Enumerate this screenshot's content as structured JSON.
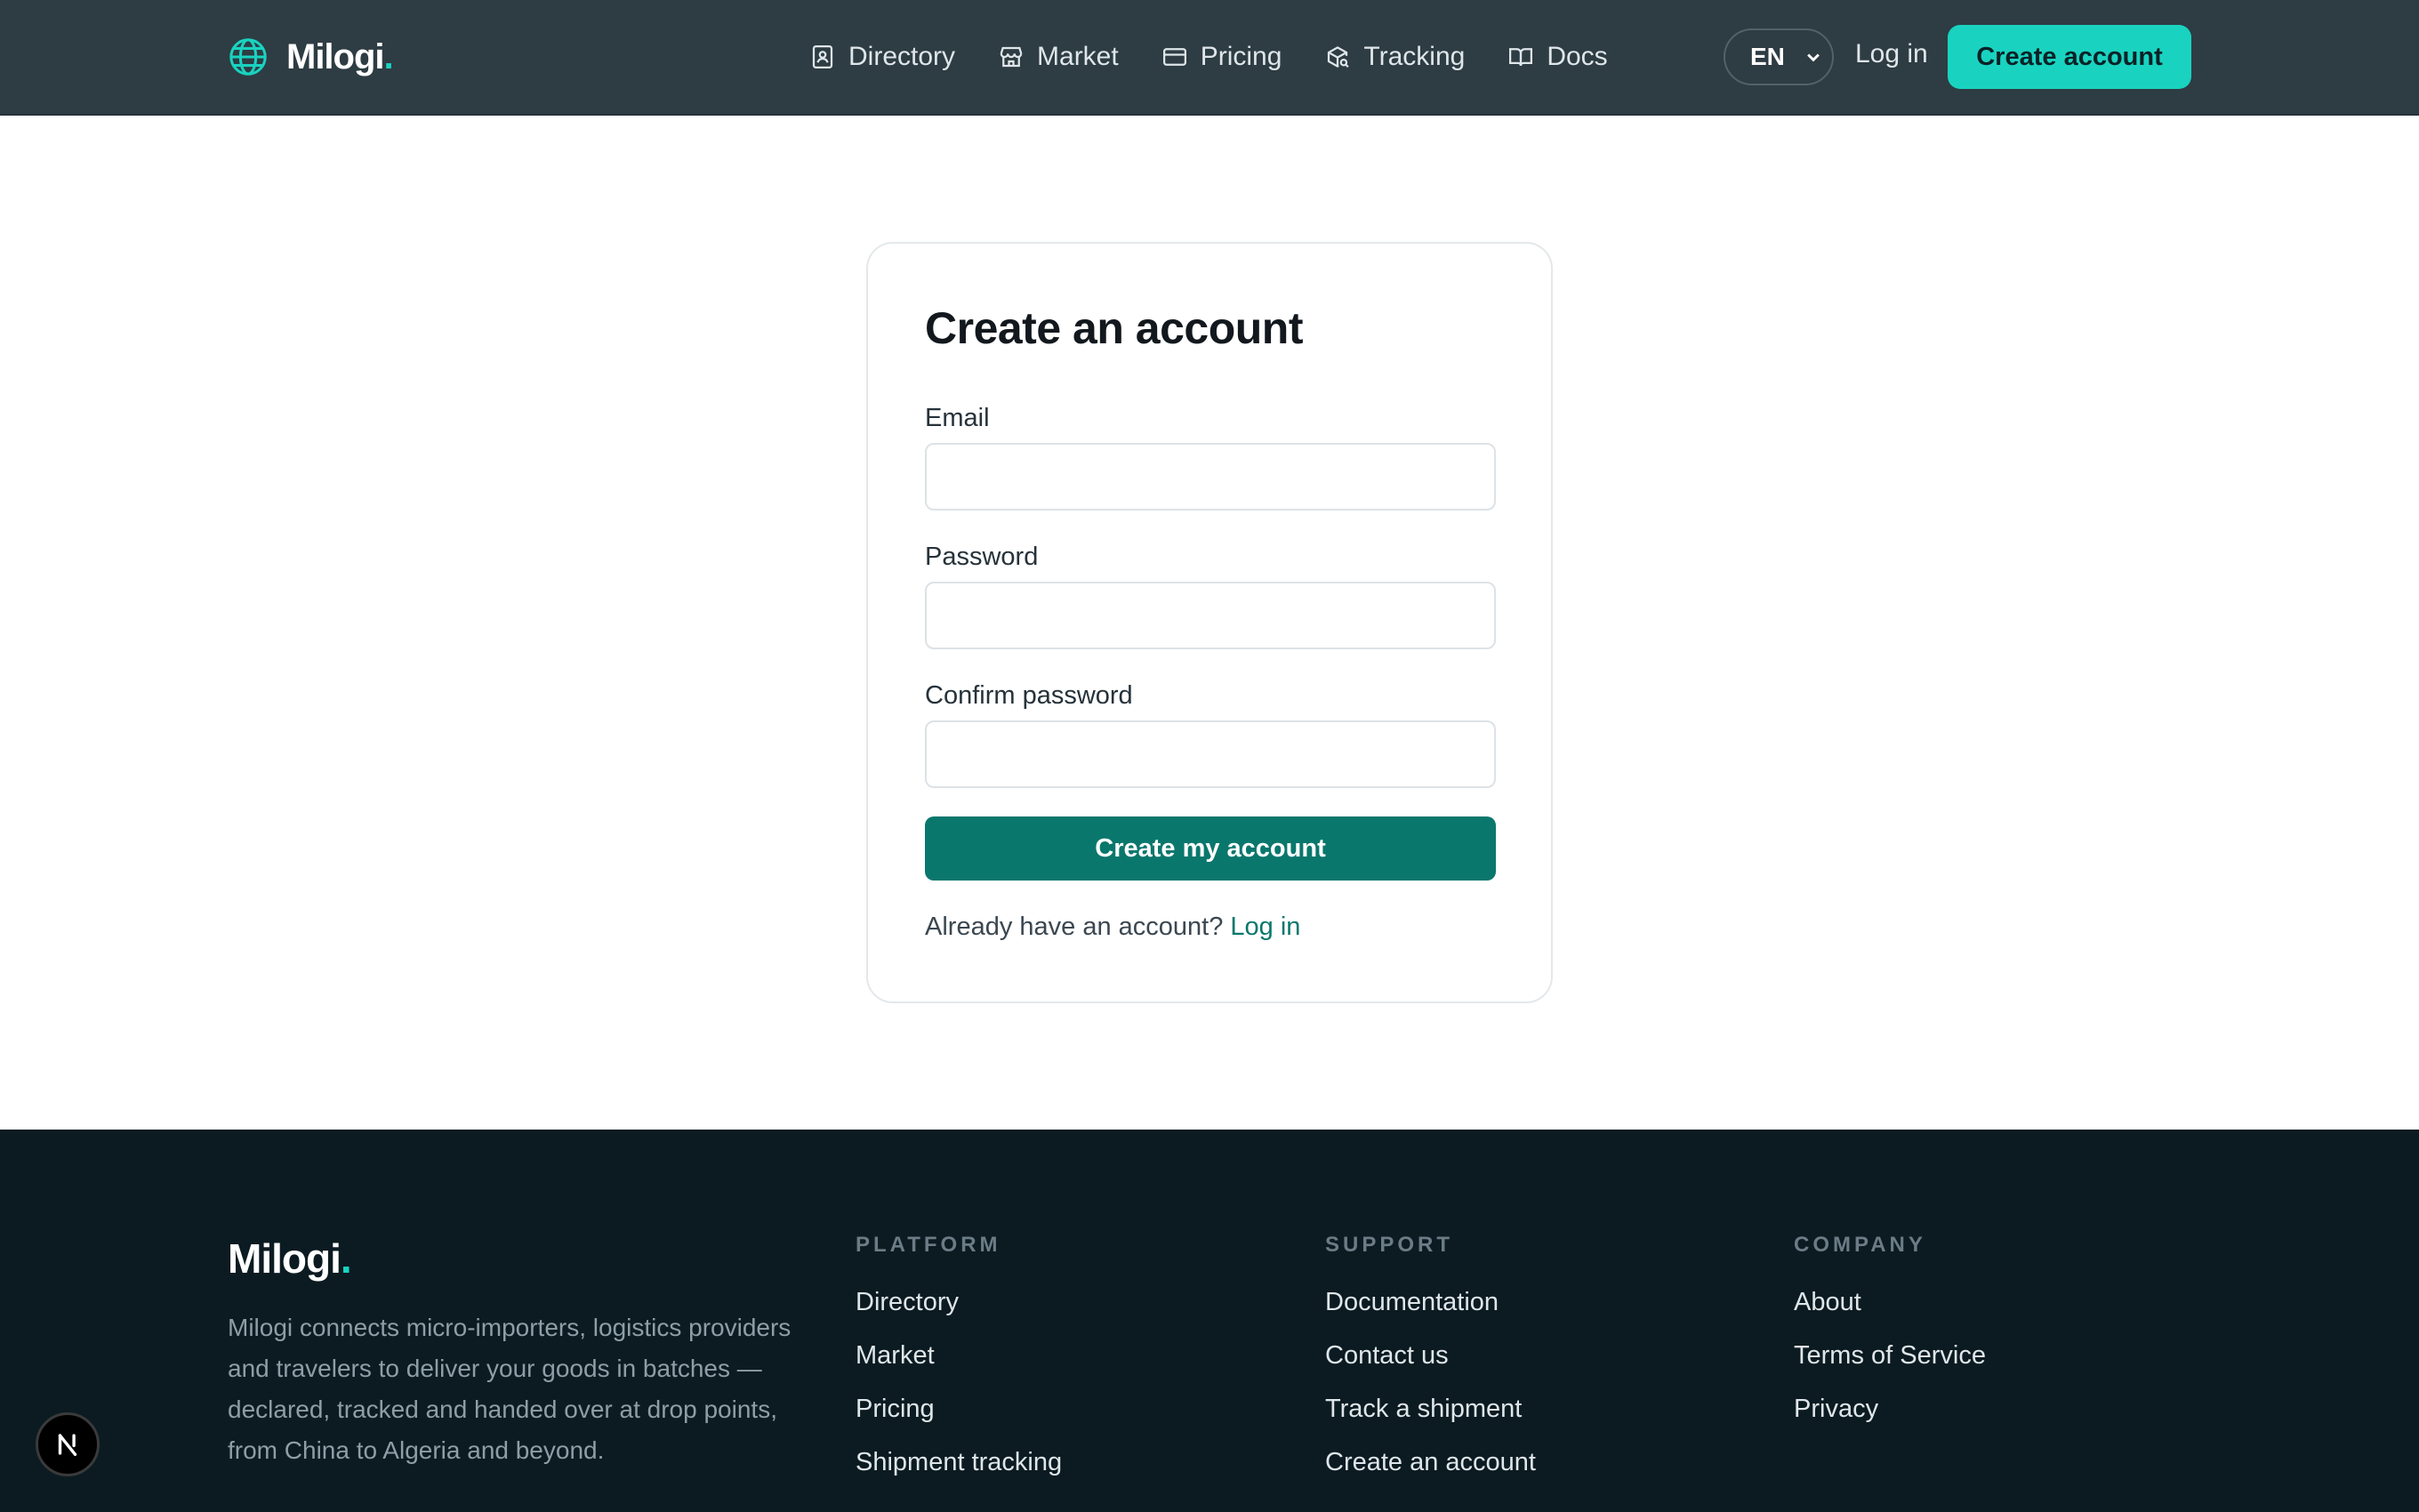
{
  "header": {
    "brand": "Milogi",
    "brand_dot": ".",
    "nav": [
      {
        "label": "Directory",
        "icon": "contact-book-icon"
      },
      {
        "label": "Market",
        "icon": "store-icon"
      },
      {
        "label": "Pricing",
        "icon": "credit-card-icon"
      },
      {
        "label": "Tracking",
        "icon": "package-search-icon"
      },
      {
        "label": "Docs",
        "icon": "open-book-icon"
      }
    ],
    "language": "EN",
    "login": "Log in",
    "cta": "Create account"
  },
  "form": {
    "title": "Create an account",
    "email_label": "Email",
    "email_value": "",
    "password_label": "Password",
    "password_value": "",
    "confirm_label": "Confirm password",
    "confirm_value": "",
    "submit": "Create my account",
    "already_text": "Already have an account?",
    "login_link": "Log in"
  },
  "footer": {
    "brand": "Milogi",
    "brand_dot": ".",
    "description": "Milogi connects micro-importers, logistics providers and travelers to deliver your goods in batches — declared, tracked and handed over at drop points, from China to Algeria and beyond.",
    "columns": [
      {
        "heading": "PLATFORM",
        "links": [
          "Directory",
          "Market",
          "Pricing",
          "Shipment tracking"
        ]
      },
      {
        "heading": "SUPPORT",
        "links": [
          "Documentation",
          "Contact us",
          "Track a shipment",
          "Create an account"
        ]
      },
      {
        "heading": "COMPANY",
        "links": [
          "About",
          "Terms of Service",
          "Privacy"
        ]
      }
    ]
  },
  "colors": {
    "accent": "#19d3c0",
    "primary": "#0a776d",
    "header_bg": "#2e3c43",
    "footer_bg": "#0b1b21"
  }
}
